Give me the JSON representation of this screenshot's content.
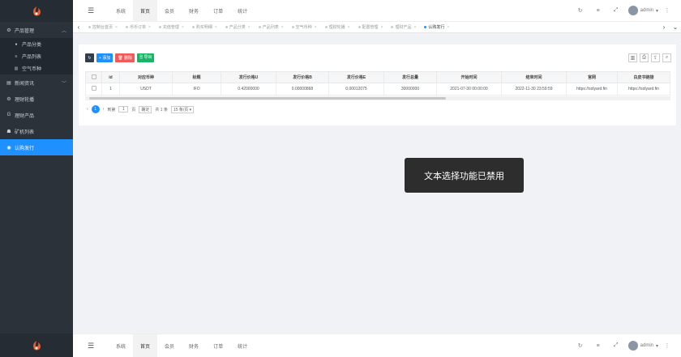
{
  "sidebar": {
    "items": [
      {
        "icon": "⚙",
        "label": "产品管理",
        "arrow": "︿"
      },
      {
        "icon": "●",
        "label": "产品分类"
      },
      {
        "icon": "≡",
        "label": "产品列表"
      },
      {
        "icon": "▥",
        "label": "空气币种"
      },
      {
        "icon": "▤",
        "label": "新闻资讯",
        "arrow": "﹀"
      },
      {
        "icon": "⚙",
        "label": "理财轮播"
      },
      {
        "icon": "G",
        "label": "理财产品"
      },
      {
        "icon": "☗",
        "label": "矿机列表"
      },
      {
        "icon": "◉",
        "label": "认购发行"
      }
    ]
  },
  "topbar": {
    "nav": [
      "系统",
      "首页",
      "会员",
      "财务",
      "订单",
      "统计"
    ],
    "active_index": 1,
    "user": "admin"
  },
  "tabs": {
    "items": [
      "控制台首页",
      "币币订单",
      "充值管理",
      "购买明细",
      "产品分类",
      "产品列表",
      "空气币种",
      "理财轮播",
      "配置管理",
      "理财产品",
      "认购发行"
    ],
    "active_index": 10
  },
  "toolbar": {
    "add": "+ 添加",
    "del": "🗑 删除",
    "export": "🗎 导出"
  },
  "table": {
    "headers": [
      "id",
      "对应币种",
      "标题",
      "发行价格U",
      "发行价格B",
      "发行价格E",
      "发行总量",
      "开始时间",
      "结束时间",
      "官网",
      "白皮书链接"
    ],
    "rows": [
      [
        "1",
        "USDT",
        "IFO",
        "0.42000000",
        "0.00000868",
        "0.00012075",
        "30000000",
        "2021-07-30 00:00:00",
        "2022-11-30 23:59:59",
        "https://solyard.fin",
        "https://solyard.fin"
      ]
    ]
  },
  "pager": {
    "current": "1",
    "goto_label": "到第",
    "page_input": "1",
    "page_unit": "页",
    "confirm": "确定",
    "total": "共 1 条",
    "page_size": "15 条/页"
  },
  "toast": "文本选择功能已禁用"
}
